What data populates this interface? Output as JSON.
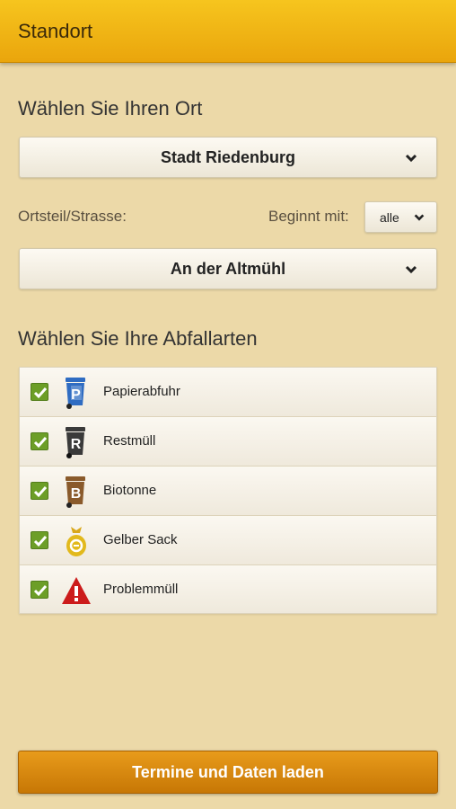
{
  "header": {
    "title": "Standort"
  },
  "location": {
    "heading": "Wählen Sie Ihren Ort",
    "selected_place": "Stadt Riedenburg",
    "street_label": "Ortsteil/Strasse:",
    "begins_with_label": "Beginnt mit:",
    "begins_with_value": "alle",
    "selected_street": "An der Altmühl"
  },
  "waste": {
    "heading": "Wählen Sie Ihre Abfallarten",
    "items": [
      {
        "label": "Papierabfuhr",
        "checked": true,
        "icon": "blue-bin-p-icon",
        "color": "#2f6cc2",
        "letter": "P"
      },
      {
        "label": "Restmüll",
        "checked": true,
        "icon": "black-bin-r-icon",
        "color": "#3a3a3a",
        "letter": "R"
      },
      {
        "label": "Biotonne",
        "checked": true,
        "icon": "brown-bin-b-icon",
        "color": "#8a5a2b",
        "letter": "B"
      },
      {
        "label": "Gelber Sack",
        "checked": true,
        "icon": "yellow-sack-icon",
        "color": "#e2b91c"
      },
      {
        "label": "Problemmüll",
        "checked": true,
        "icon": "warning-triangle-icon",
        "color": "#cc1b1b"
      }
    ]
  },
  "actions": {
    "load_label": "Termine und Daten laden"
  },
  "colors": {
    "accent": "#eaa50c",
    "button": "#d8870f",
    "checkbox": "#6c9e27",
    "background": "#ecd9a8"
  }
}
